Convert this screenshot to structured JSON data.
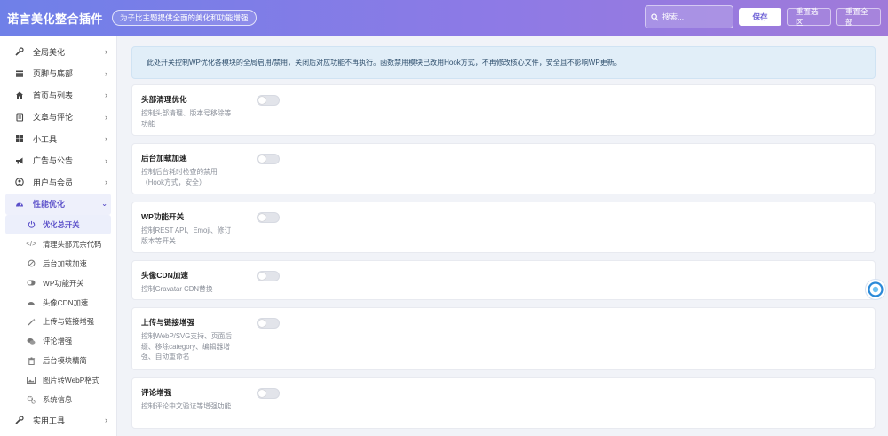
{
  "header": {
    "title": "诺言美化整合插件",
    "tagline": "为子比主题提供全面的美化和功能增强",
    "search_placeholder": "搜索...",
    "save_label": "保存",
    "reset_section_label": "重置选区",
    "reset_all_label": "重置全部"
  },
  "sidebar": {
    "items": [
      {
        "label": "全局美化",
        "icon": "wrench-icon"
      },
      {
        "label": "页脚与底部",
        "icon": "bars-icon"
      },
      {
        "label": "首页与列表",
        "icon": "home-icon"
      },
      {
        "label": "文章与评论",
        "icon": "document-icon"
      },
      {
        "label": "小工具",
        "icon": "grid-icon"
      },
      {
        "label": "广告与公告",
        "icon": "megaphone-icon"
      },
      {
        "label": "用户与会员",
        "icon": "user-circle-icon"
      },
      {
        "label": "性能优化",
        "icon": "gauge-icon",
        "active": true
      },
      {
        "label": "实用工具",
        "icon": "wrench-icon"
      }
    ],
    "sub_items": [
      {
        "label": "优化总开关",
        "icon": "power-icon",
        "active": true
      },
      {
        "label": "清理头部冗余代码",
        "icon": "code-icon"
      },
      {
        "label": "后台加载加速",
        "icon": "ban-icon"
      },
      {
        "label": "WP功能开关",
        "icon": "toggle-icon"
      },
      {
        "label": "头像CDN加速",
        "icon": "gauge-icon"
      },
      {
        "label": "上传与链接增强",
        "icon": "wand-icon"
      },
      {
        "label": "评论增强",
        "icon": "comments-icon"
      },
      {
        "label": "后台模块精简",
        "icon": "trash-icon"
      },
      {
        "label": "图片转WebP格式",
        "icon": "image-icon"
      },
      {
        "label": "系统信息",
        "icon": "gears-icon"
      }
    ]
  },
  "notice": "此处开关控制WP优化各模块的全局启用/禁用，关闭后对应功能不再执行。函数禁用模块已改用Hook方式，不再修改核心文件，安全且不影响WP更新。",
  "cards": [
    {
      "title": "头部清理优化",
      "desc": "控制头部清理、版本号移除等功能",
      "enabled": false
    },
    {
      "title": "后台加载加速",
      "desc": "控制后台耗时检查的禁用（Hook方式，安全）",
      "enabled": false
    },
    {
      "title": "WP功能开关",
      "desc": "控制REST API、Emoji、修订版本等开关",
      "enabled": false
    },
    {
      "title": "头像CDN加速",
      "desc": "控制Gravatar CDN替换",
      "enabled": false
    },
    {
      "title": "上传与链接增强",
      "desc": "控制WebP/SVG支持、页面后缀、移除category、编辑器增强、自动重命名",
      "enabled": false
    },
    {
      "title": "评论增强",
      "desc": "控制评论中文验证等增强功能",
      "enabled": false
    }
  ],
  "colors": {
    "header_start": "#6f80e8",
    "header_end": "#a07ad9",
    "accent": "#5a4fc9",
    "notice_bg": "#e1eef8"
  }
}
